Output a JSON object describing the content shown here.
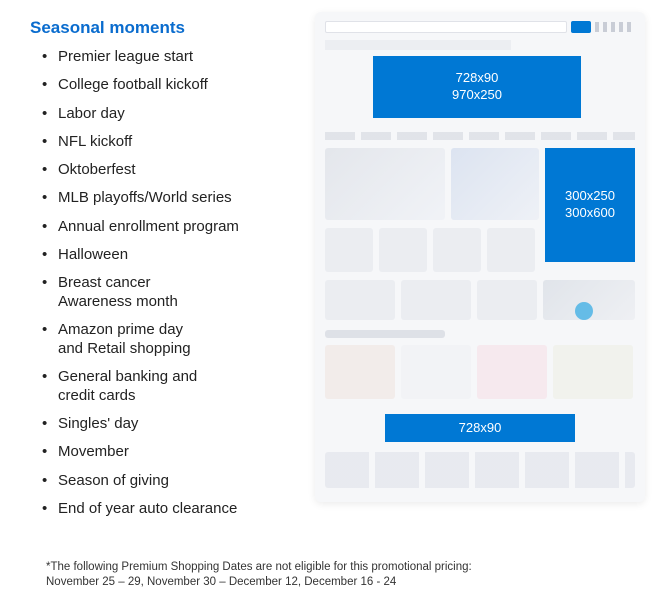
{
  "title": "Seasonal moments",
  "moments": [
    "Premier league start",
    "College football kickoff",
    "Labor day",
    "NFL kickoff",
    "Oktoberfest",
    "MLB playoffs/World series",
    "Annual enrollment program",
    "Halloween",
    "Breast cancer\nAwareness month",
    "Amazon prime day\nand Retail shopping",
    "General banking and\ncredit cards",
    "Singles' day",
    "Movember",
    "Season of giving",
    "End of year auto clearance"
  ],
  "ads": {
    "top": {
      "line1": "728x90",
      "line2": "970x250"
    },
    "side": {
      "line1": "300x250",
      "line2": "300x600"
    },
    "bottom": {
      "line1": "728x90"
    }
  },
  "footnote": {
    "line1": "*The following Premium Shopping Dates are not eligible for this promotional pricing:",
    "line2": "November 25 – 29, November 30 – December 12, December 16 - 24"
  }
}
